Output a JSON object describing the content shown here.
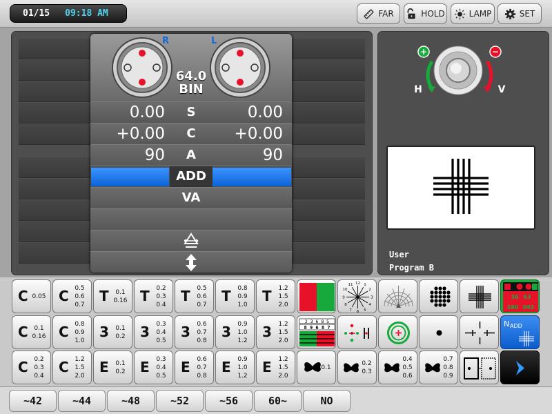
{
  "topbar": {
    "date": "01/15",
    "time": "09:18 AM",
    "buttons": [
      {
        "label": "FAR",
        "icon": "ruler-icon"
      },
      {
        "label": "HOLD",
        "icon": "unlock-icon"
      },
      {
        "label": "LAMP",
        "icon": "sun-icon"
      },
      {
        "label": "SET",
        "icon": "gear-icon"
      }
    ]
  },
  "refraction": {
    "right_tag": "R",
    "left_tag": "L",
    "pd": "64.0",
    "mode": "BIN",
    "rows": [
      {
        "label": "S",
        "right": "0.00",
        "left": "0.00"
      },
      {
        "label": "C",
        "right": "+0.00",
        "left": "+0.00"
      },
      {
        "label": "A",
        "right": "90",
        "left": "90"
      },
      {
        "label": "ADD",
        "right": "",
        "left": ""
      },
      {
        "label": "VA",
        "right": "",
        "left": ""
      }
    ]
  },
  "knob": {
    "h_label": "H",
    "v_label": "V",
    "plus": "+",
    "minus": "−"
  },
  "user": {
    "line1": "User",
    "line2": "Program B"
  },
  "grid": {
    "row1": [
      {
        "letter": "C",
        "vals": [
          "0.05"
        ]
      },
      {
        "letter": "C",
        "vals": [
          "0.5",
          "0.6",
          "0.7"
        ]
      },
      {
        "letter": "T",
        "vals": [
          "0.1",
          "0.16"
        ]
      },
      {
        "letter": "T",
        "vals": [
          "0.2",
          "0.3",
          "0.4"
        ]
      },
      {
        "letter": "T",
        "vals": [
          "0.5",
          "0.6",
          "0.7"
        ]
      },
      {
        "letter": "T",
        "vals": [
          "0.8",
          "0.9",
          "1.0"
        ]
      },
      {
        "letter": "T",
        "vals": [
          "1.2",
          "1.5",
          "2.0"
        ]
      }
    ],
    "row2": [
      {
        "letter": "C",
        "vals": [
          "0.1",
          "0.16"
        ]
      },
      {
        "letter": "C",
        "vals": [
          "0.8",
          "0.9",
          "1.0"
        ]
      },
      {
        "letter": "3",
        "vals": [
          "0.1",
          "0.2"
        ]
      },
      {
        "letter": "3",
        "vals": [
          "0.3",
          "0.4",
          "0.5"
        ]
      },
      {
        "letter": "3",
        "vals": [
          "0.6",
          "0.7",
          "0.8"
        ]
      },
      {
        "letter": "3",
        "vals": [
          "0.9",
          "1.0",
          "1.2"
        ]
      },
      {
        "letter": "3",
        "vals": [
          "1.2",
          "1.5",
          "2.0"
        ]
      }
    ],
    "row3": [
      {
        "letter": "C",
        "vals": [
          "0.2",
          "0.3",
          "0.4"
        ]
      },
      {
        "letter": "C",
        "vals": [
          "1.2",
          "1.5",
          "2.0"
        ]
      },
      {
        "letter": "E",
        "vals": [
          "0.1",
          "0.2"
        ]
      },
      {
        "letter": "E",
        "vals": [
          "0.3",
          "0.4",
          "0.5"
        ]
      },
      {
        "letter": "E",
        "vals": [
          "0.6",
          "0.7",
          "0.8"
        ]
      },
      {
        "letter": "E",
        "vals": [
          "0.9",
          "1.0",
          "1.2"
        ]
      },
      {
        "letter": "E",
        "vals": [
          "1.2",
          "1.5",
          "2.0"
        ]
      }
    ],
    "butterflies": [
      {
        "vals": [
          "0.1"
        ]
      },
      {
        "vals": [
          "0.2",
          "0.3"
        ]
      },
      {
        "vals": [
          "0.4",
          "0.5",
          "0.6"
        ]
      },
      {
        "vals": [
          "0.7",
          "0.8",
          "0.9"
        ]
      }
    ],
    "special": {
      "clock_numbers": [
        "12",
        "1",
        "2",
        "3",
        "4",
        "5",
        "6",
        "7",
        "8",
        "9",
        "10",
        "11"
      ],
      "ishihara_values": [
        "36",
        "63",
        "280",
        "092"
      ],
      "worth_strip": "2 3 6 8 5",
      "worth_strip2": "8 9 6 8 7",
      "near_add_label": "N",
      "near_add_sub": "ADD"
    }
  },
  "bottombar": {
    "buttons": [
      "~42",
      "~44",
      "~48",
      "~52",
      "~56",
      "60~",
      "NO"
    ]
  },
  "colors": {
    "accent_blue": "#1669d8",
    "red": "#e8112a",
    "green": "#17a93b",
    "clock_time": "#4fd4f2"
  }
}
